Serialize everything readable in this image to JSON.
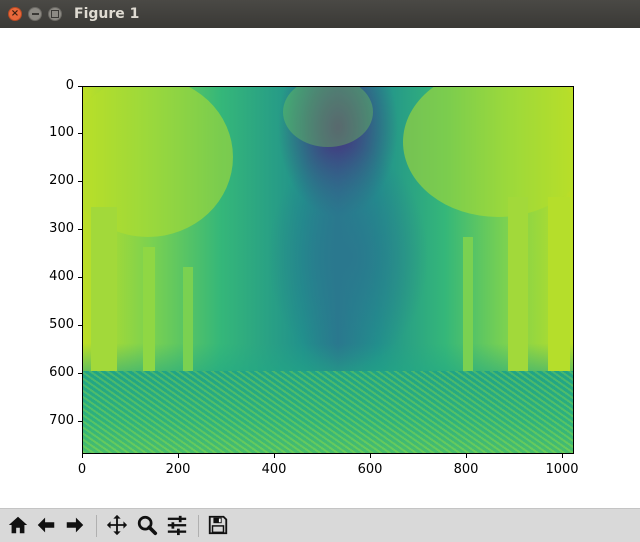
{
  "window": {
    "title": "Figure 1",
    "controls": [
      "close",
      "minimize",
      "maximize"
    ]
  },
  "plot": {
    "type": "image",
    "colormap": "viridis",
    "y_ticks": [
      "0",
      "100",
      "200",
      "300",
      "400",
      "500",
      "600",
      "700"
    ],
    "x_ticks": [
      "0",
      "200",
      "400",
      "600",
      "800",
      "1000"
    ]
  },
  "toolbar": {
    "buttons": [
      {
        "name": "home-icon"
      },
      {
        "name": "back-arrow-icon"
      },
      {
        "name": "forward-arrow-icon"
      },
      {
        "name": "pan-icon"
      },
      {
        "name": "zoom-icon"
      },
      {
        "name": "configure-subplots-icon"
      },
      {
        "name": "save-icon"
      }
    ]
  }
}
